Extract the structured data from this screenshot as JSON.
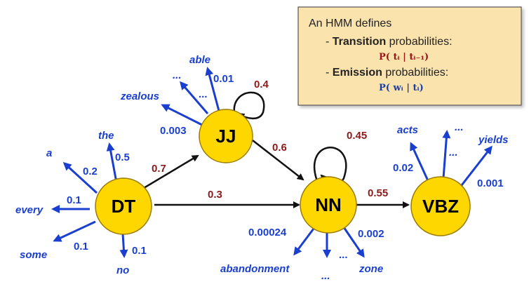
{
  "info_box": {
    "line1": "An HMM defines",
    "transition_bullet": "- ",
    "transition_bold": "Transition",
    "transition_rest": " probabilities:",
    "transition_formula": "P( tᵢ | tᵢ₋₁)",
    "emission_bullet": "- ",
    "emission_bold": "Emission",
    "emission_rest": " probabilities:",
    "emission_formula": "P( wᵢ | tᵢ)"
  },
  "states": {
    "dt": "DT",
    "jj": "JJ",
    "nn": "NN",
    "vbz": "VBZ"
  },
  "transitions": {
    "dt_jj": "0.7",
    "dt_nn": "0.3",
    "jj_jj": "0.4",
    "jj_nn": "0.6",
    "nn_nn": "0.45",
    "nn_vbz": "0.55"
  },
  "emissions": {
    "dt": {
      "every": {
        "word": "every",
        "prob": "0.1"
      },
      "a": {
        "word": "a",
        "prob": "0.2"
      },
      "the": {
        "word": "the",
        "prob": "0.5"
      },
      "some": {
        "word": "some",
        "prob": "0.1"
      },
      "no": {
        "word": "no",
        "prob": "0.1"
      }
    },
    "jj": {
      "zealous": {
        "word": "zealous",
        "prob": "0.003"
      },
      "dots": {
        "word": "...",
        "prob": "..."
      },
      "able": {
        "word": "able",
        "prob": "0.01"
      }
    },
    "nn": {
      "abandonment": {
        "word": "abandonment",
        "prob": "0.00024"
      },
      "dots": {
        "word": "...",
        "prob": "..."
      },
      "zone": {
        "word": "zone",
        "prob": "0.002"
      }
    },
    "vbz": {
      "acts": {
        "word": "acts",
        "prob": "0.02"
      },
      "dots": {
        "word": "..."
      },
      "yields": {
        "word": "yields",
        "prob": "0.001"
      }
    }
  },
  "colors": {
    "node_fill": "#ffd700",
    "node_stroke": "#9a7b00",
    "transition_edge": "#111111",
    "emission_edge": "#1a3fd0",
    "box_fill": "#fbe3ae",
    "box_stroke": "#555555"
  }
}
